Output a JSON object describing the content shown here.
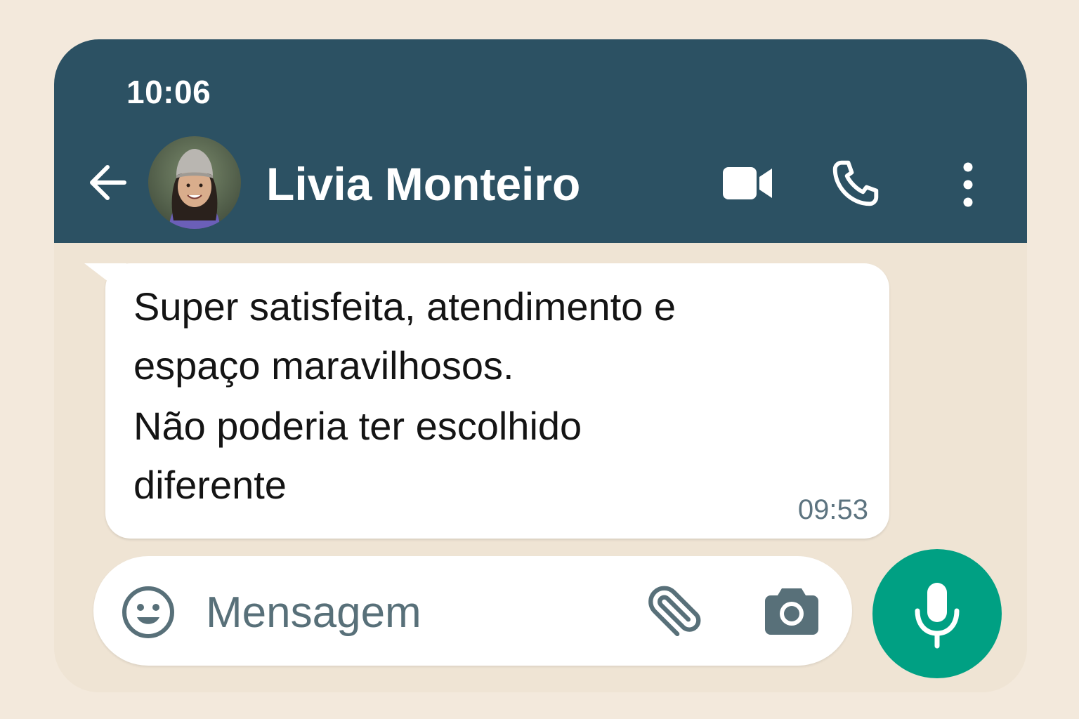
{
  "status_bar": {
    "time": "10:06"
  },
  "header": {
    "contact_name": "Livia Monteiro",
    "back_icon": "arrow-left-icon",
    "video_icon": "video-camera-icon",
    "call_icon": "phone-icon",
    "menu_icon": "more-vertical-icon",
    "background_color": "#2c5163"
  },
  "messages": [
    {
      "direction": "incoming",
      "lines": [
        "Super satisfeita, atendimento e",
        "espaço maravilhosos.",
        "Não poderia ter escolhido",
        "diferente"
      ],
      "time": "09:53"
    }
  ],
  "composer": {
    "placeholder": "Mensagem",
    "value": "",
    "emoji_icon": "emoji-icon",
    "attach_icon": "paperclip-icon",
    "camera_icon": "camera-icon",
    "mic_icon": "microphone-icon",
    "mic_color": "#00a083"
  }
}
